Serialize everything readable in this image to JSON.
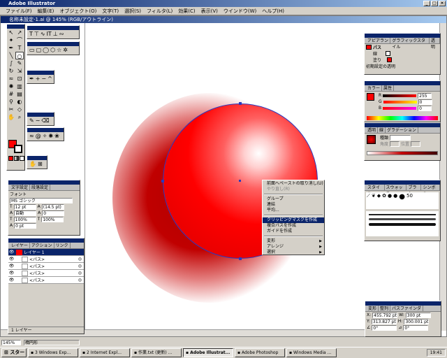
{
  "app": {
    "title": "Adobe Illustrator",
    "document_title": "名称未設定-1.ai @ 145% (RGB/アウトライン)"
  },
  "menu": [
    "ファイル(F)",
    "編集(E)",
    "オブジェクト(O)",
    "文字(T)",
    "選択(S)",
    "フィルタ(L)",
    "効果(C)",
    "表示(V)",
    "ウインドウ(W)",
    "ヘルプ(H)"
  ],
  "context_menu": {
    "items": [
      {
        "label": "前面へペーストの取り消し(U)",
        "state": "normal"
      },
      {
        "label": "やり直し(R)",
        "state": "disabled"
      },
      {
        "sep": true
      },
      {
        "label": "グループ",
        "state": "normal"
      },
      {
        "label": "連結",
        "state": "normal"
      },
      {
        "label": "平均...",
        "state": "normal"
      },
      {
        "sep": true
      },
      {
        "label": "クリッピングマスクを作成",
        "state": "highlighted"
      },
      {
        "label": "複合パスを作成",
        "state": "normal"
      },
      {
        "label": "ガイドを作成",
        "state": "normal"
      },
      {
        "sep": true
      },
      {
        "label": "変形",
        "state": "normal",
        "submenu": true
      },
      {
        "label": "アレンジ",
        "state": "normal",
        "submenu": true
      },
      {
        "label": "選択",
        "state": "normal",
        "submenu": true
      }
    ]
  },
  "appearance_panel": {
    "tabs": [
      "アピアランス",
      "グラフィックスタイル",
      "透明"
    ],
    "path_label": "パス",
    "stroke_label": "線",
    "fill_label": "塗り",
    "default_transparency": "初期設定の透明"
  },
  "color_panel": {
    "tabs": [
      "カラー",
      "属性"
    ],
    "channels": [
      {
        "label": "R",
        "value": "255"
      },
      {
        "label": "G",
        "value": "0"
      },
      {
        "label": "B",
        "value": "0"
      }
    ]
  },
  "gradient_panel": {
    "tabs": [
      "透明",
      "線",
      "グラデーション"
    ],
    "type_label": "種類",
    "angle_label": "角度",
    "location_label": "位置"
  },
  "brush_panel": {
    "tabs": [
      "スタイル",
      "スウォッチ",
      "ブラシ",
      "シンボル"
    ],
    "size_label": "50"
  },
  "character_panel": {
    "tabs": [
      "文字設定",
      "段落設定"
    ],
    "font_label": "フォント",
    "font_value": "MS ゴシック",
    "size_value": "12 pt",
    "leading_value": "(14.5 pt)",
    "tracking_value": "自動",
    "kerning_value": "0",
    "h_scale_value": "100%",
    "v_scale_value": "100%",
    "baseline_value": "0 pt"
  },
  "layers_panel": {
    "tabs": [
      "レイヤー",
      "アクション",
      "リンク"
    ],
    "layer_name": "レイヤー 1",
    "items": [
      "<パス>",
      "<パス>",
      "<パス>",
      "<パス>"
    ],
    "footer": "1 レイヤー"
  },
  "transform_panel": {
    "tabs": [
      "変形",
      "整列",
      "パスファインダ"
    ],
    "x_label": "X:",
    "x_value": "455.792 pt",
    "y_label": "Y:",
    "y_value": "313.827 pt",
    "w_label": "W:",
    "w_value": "300 pt",
    "h_label": "H:",
    "h_value": "300.001 pt",
    "angle1": "0°",
    "angle2": "0°"
  },
  "status": {
    "zoom": "145%",
    "tool": "楕円形"
  },
  "taskbar": {
    "start": "スタート",
    "tasks": [
      {
        "label": "3 Windows Exp...",
        "active": false
      },
      {
        "label": "2 Internet Expl...",
        "active": false
      },
      {
        "label": "作業.txt (更新) ...",
        "active": false
      },
      {
        "label": "Adobe Illustrat...",
        "active": true
      },
      {
        "label": "Adobe Photoshop",
        "active": false
      },
      {
        "label": "Windows Media ...",
        "active": false
      }
    ],
    "clock": "19:41"
  },
  "colors": {
    "accent": "#ff0000",
    "titlebar": "#0a246a"
  }
}
